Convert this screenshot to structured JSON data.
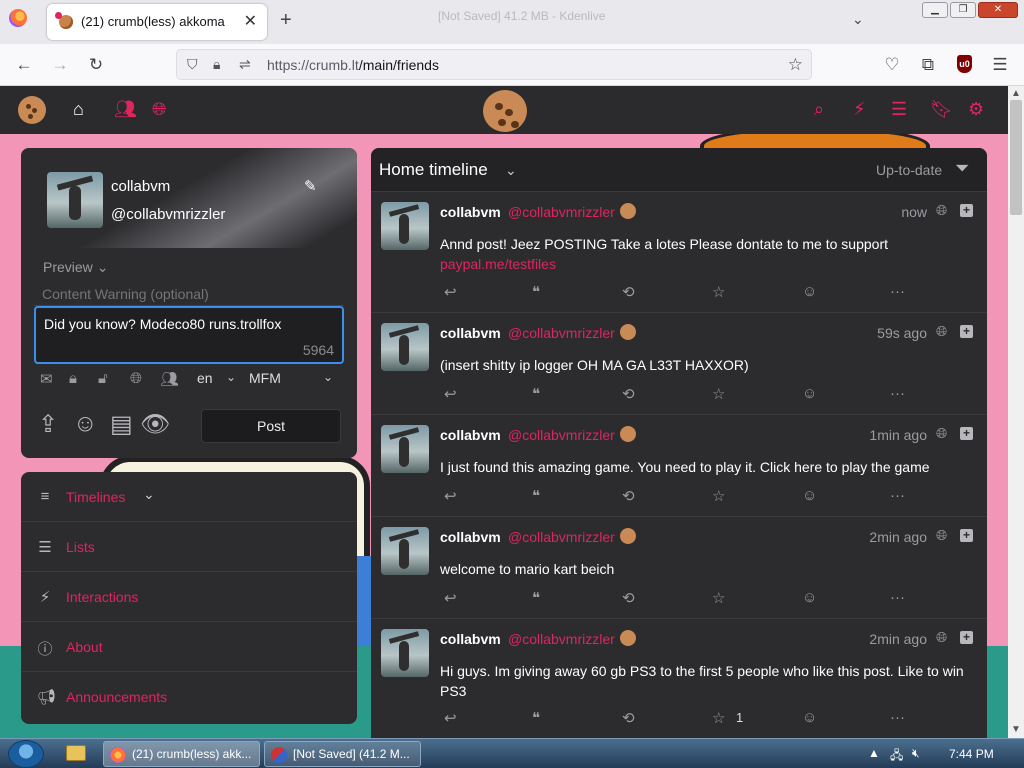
{
  "browser": {
    "tab_title": "(21) crumb(less) akkoma",
    "tab_close": "✕",
    "ghost_title": "[Not Saved] 41.2 MB - Kdenlive",
    "url_host": "https://crumb.lt",
    "url_path": "/main/friends"
  },
  "site": {
    "accent": "#e0245e",
    "user": {
      "name": "collabvm",
      "handle": "@collabvmrizzler"
    },
    "composer": {
      "preview_label": "Preview",
      "cw_placeholder": "Content Warning (optional)",
      "text": "Did you know? Modeco80 runs.trollfox",
      "char_count": "5964",
      "language": "en",
      "format": "MFM",
      "post_label": "Post"
    },
    "nav": [
      {
        "label": "Timelines",
        "icon": "bars-icon"
      },
      {
        "label": "Lists",
        "icon": "list-icon"
      },
      {
        "label": "Interactions",
        "icon": "bolt-icon"
      },
      {
        "label": "About",
        "icon": "info-icon"
      },
      {
        "label": "Announcements",
        "icon": "bullhorn-icon"
      }
    ],
    "timeline": {
      "title": "Home timeline",
      "status": "Up-to-date",
      "posts": [
        {
          "name": "collabvm",
          "handle": "@collabvmrizzler",
          "time": "now",
          "text": "Annd post! Jeez  POSTING Take a lotes Please dontate to me to support",
          "link": "paypal.me/testfiles",
          "likes": ""
        },
        {
          "name": "collabvm",
          "handle": "@collabvmrizzler",
          "time": "59s ago",
          "text": "(insert shitty ip logger OH MA GA L33T HAXXOR)",
          "link": "",
          "likes": ""
        },
        {
          "name": "collabvm",
          "handle": "@collabvmrizzler",
          "time": "1min ago",
          "text": "I just found this amazing game. You need to play it. Click here to play the game",
          "link": "",
          "likes": ""
        },
        {
          "name": "collabvm",
          "handle": "@collabvmrizzler",
          "time": "2min ago",
          "text": "welcome to mario kart beich",
          "link": "",
          "likes": ""
        },
        {
          "name": "collabvm",
          "handle": "@collabvmrizzler",
          "time": "2min ago",
          "text": "Hi guys. Im giving away 60 gb PS3 to the first 5 people who like this post. Like to win PS3",
          "link": "",
          "likes": "1"
        }
      ]
    }
  },
  "taskbar": {
    "tasks": [
      {
        "label": "(21) crumb(less) akk..."
      },
      {
        "label": "[Not Saved] (41.2 M..."
      }
    ],
    "clock": "7:44 PM"
  }
}
